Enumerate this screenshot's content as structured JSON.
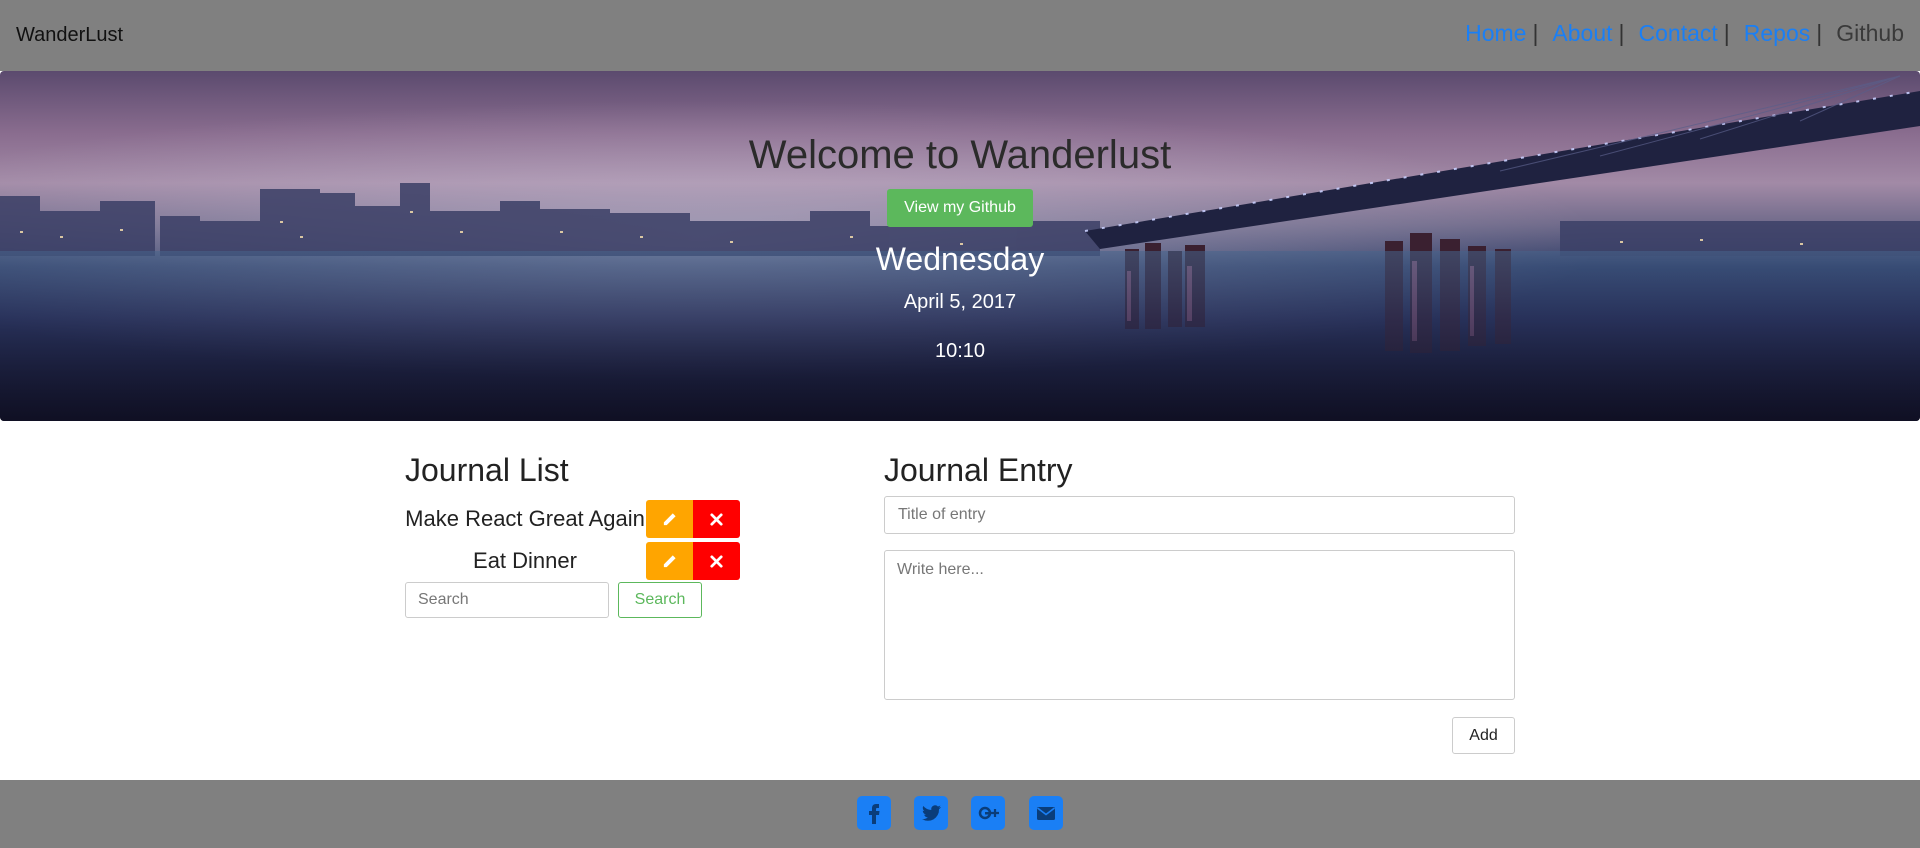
{
  "navbar": {
    "brand": "WanderLust",
    "links": [
      "Home",
      "About",
      "Contact",
      "Repos",
      "Github"
    ],
    "separator": "|"
  },
  "hero": {
    "title": "Welcome to Wanderlust",
    "github_button": "View my Github",
    "day": "Wednesday",
    "date": "April 5, 2017",
    "time": "10:10"
  },
  "journal_list": {
    "title": "Journal List",
    "items": [
      {
        "label": "Make React Great Again"
      },
      {
        "label": "Eat Dinner"
      }
    ],
    "search_placeholder": "Search",
    "search_button": "Search"
  },
  "journal_entry": {
    "title": "Journal Entry",
    "title_placeholder": "Title of entry",
    "body_placeholder": "Write here...",
    "add_button": "Add"
  },
  "footer": {
    "icons": [
      "facebook-icon",
      "twitter-icon",
      "google-plus-icon",
      "envelope-icon"
    ]
  },
  "colors": {
    "nav_bg": "#808080",
    "link": "#1a7ff5",
    "github_button": "#5cb85c",
    "edit_button": "#ffa500",
    "delete_button": "#ff0000",
    "social_icon": "#1a7ff5"
  }
}
